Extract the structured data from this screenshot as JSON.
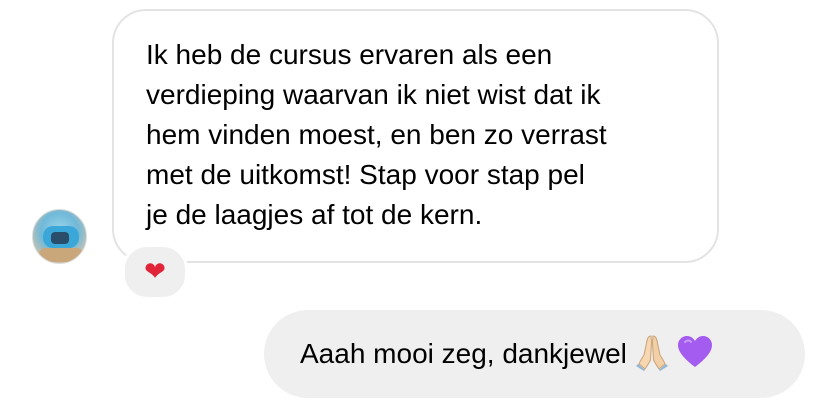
{
  "conversation": {
    "incoming": {
      "text": "Ik heb de cursus ervaren als een\nverdieping waarvan ik niet wist dat ik\nhem vinden moest, en ben zo verrast\nmet de uitkomst! Stap voor stap pel\nje de laagjes af tot de kern.",
      "reaction": "❤"
    },
    "outgoing": {
      "text": "Aaah mooi zeg, dankjewel",
      "emojis": [
        "folded-hands-icon",
        "purple-heart-icon"
      ]
    }
  },
  "colors": {
    "incoming_border": "#e3e3e3",
    "outgoing_bg": "#efefef",
    "reaction_heart": "#e0243a",
    "purple_heart": "#a45bf0"
  }
}
